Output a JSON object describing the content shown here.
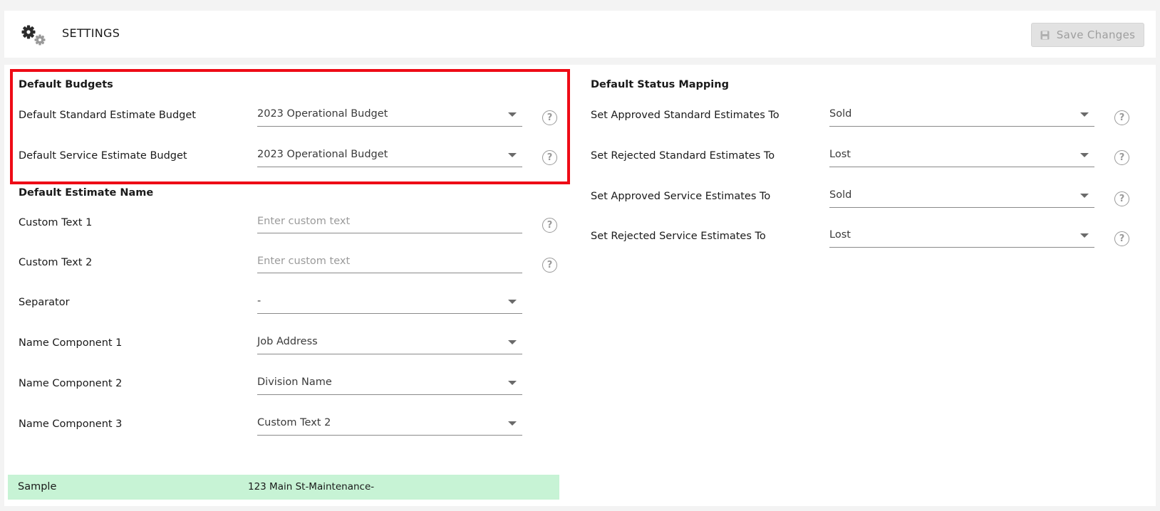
{
  "header": {
    "title": "SETTINGS",
    "save_label": "Save Changes",
    "icon": "gears-icon"
  },
  "default_budgets": {
    "title": "Default Budgets",
    "rows": [
      {
        "label": "Default Standard Estimate Budget",
        "value": "2023 Operational Budget"
      },
      {
        "label": "Default Service Estimate Budget",
        "value": "2023 Operational Budget"
      }
    ]
  },
  "default_estimate_name": {
    "title": "Default Estimate Name",
    "custom_text_1": {
      "label": "Custom Text 1",
      "value": "",
      "placeholder": "Enter custom text"
    },
    "custom_text_2": {
      "label": "Custom Text 2",
      "value": "",
      "placeholder": "Enter custom text"
    },
    "separator": {
      "label": "Separator",
      "value": "-"
    },
    "name_component_1": {
      "label": "Name Component 1",
      "value": "Job Address"
    },
    "name_component_2": {
      "label": "Name Component 2",
      "value": "Division Name"
    },
    "name_component_3": {
      "label": "Name Component 3",
      "value": "Custom Text 2"
    },
    "sample": {
      "label": "Sample",
      "value": "123 Main St-Maintenance-"
    }
  },
  "default_status_mapping": {
    "title": "Default Status Mapping",
    "rows": [
      {
        "label": "Set Approved Standard Estimates To",
        "value": "Sold"
      },
      {
        "label": "Set Rejected Standard Estimates To",
        "value": "Lost"
      },
      {
        "label": "Set Approved Service Estimates To",
        "value": "Sold"
      },
      {
        "label": "Set Rejected Service Estimates To",
        "value": "Lost"
      }
    ]
  },
  "help_glyph": "?",
  "colors": {
    "highlight_border": "#ee0b16",
    "sample_background": "#c7f3d5",
    "save_button_disabled": "#e2e2e2"
  }
}
